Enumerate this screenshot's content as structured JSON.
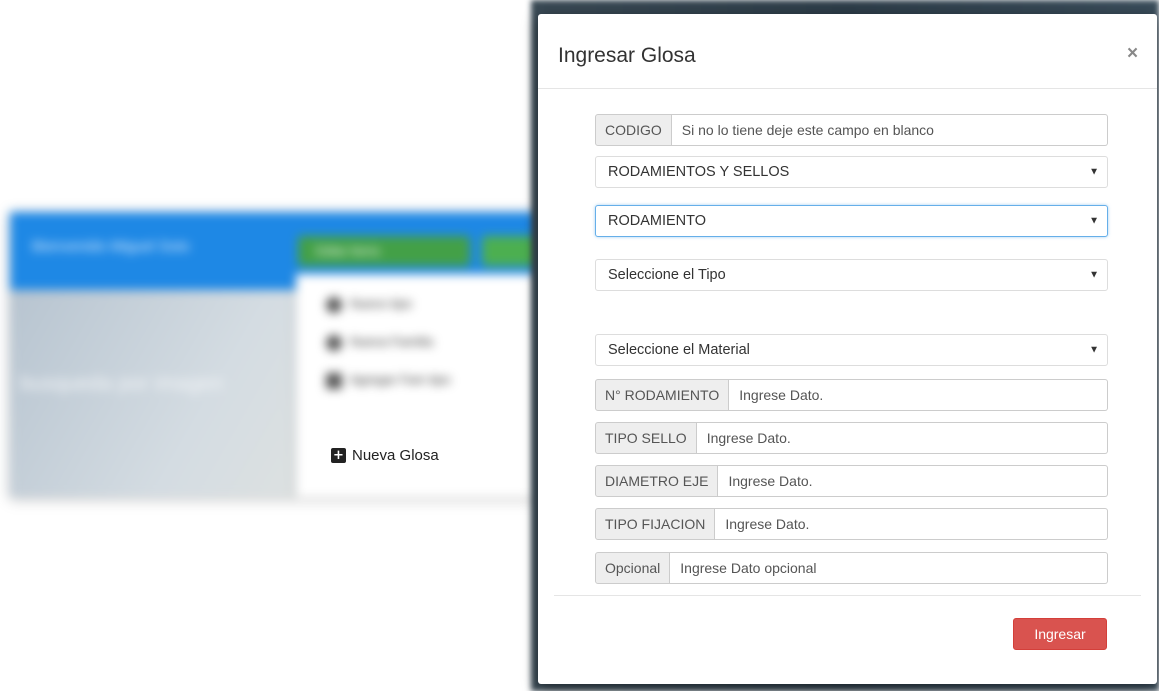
{
  "background": {
    "brand": "Bienvenido Miguel Soto",
    "edit_button_label": "Editar Items",
    "hero_text": "busqueda por imagen",
    "dropdown_items": [
      {
        "icon": "circle-icon",
        "label": "Nuevo tipo"
      },
      {
        "icon": "circle-icon",
        "label": "Nueva Familia"
      },
      {
        "icon": "folder-icon",
        "label": "Agregar Fam tipo"
      }
    ],
    "new_glosa_label": "Nueva Glosa",
    "new_glosa_icon": "plus-square-icon"
  },
  "modal": {
    "title": "Ingresar Glosa",
    "close_label": "×",
    "fields": {
      "codigo": {
        "label": "CODIGO",
        "placeholder": "Si no lo tiene deje este campo en blanco"
      },
      "familia": {
        "value": "RODAMIENTOS Y SELLOS"
      },
      "subfamilia": {
        "value": "RODAMIENTO"
      },
      "tipo": {
        "value": "Seleccione el Tipo"
      },
      "material": {
        "value": "Seleccione el Material"
      },
      "n_rodamiento": {
        "label": "N° RODAMIENTO",
        "placeholder": "Ingrese Dato."
      },
      "tipo_sello": {
        "label": "TIPO SELLO",
        "placeholder": "Ingrese Dato."
      },
      "diametro_eje": {
        "label": "DIAMETRO EJE",
        "placeholder": "Ingrese Dato."
      },
      "tipo_fijacion": {
        "label": "TIPO FIJACION",
        "placeholder": "Ingrese Dato."
      },
      "opcional": {
        "label": "Opcional",
        "placeholder": "Ingrese Dato opcional"
      }
    },
    "submit_label": "Ingresar"
  },
  "colors": {
    "navbar": "#1e88e5",
    "submit_button": "#d9534f",
    "focus_border": "#66afe9"
  }
}
